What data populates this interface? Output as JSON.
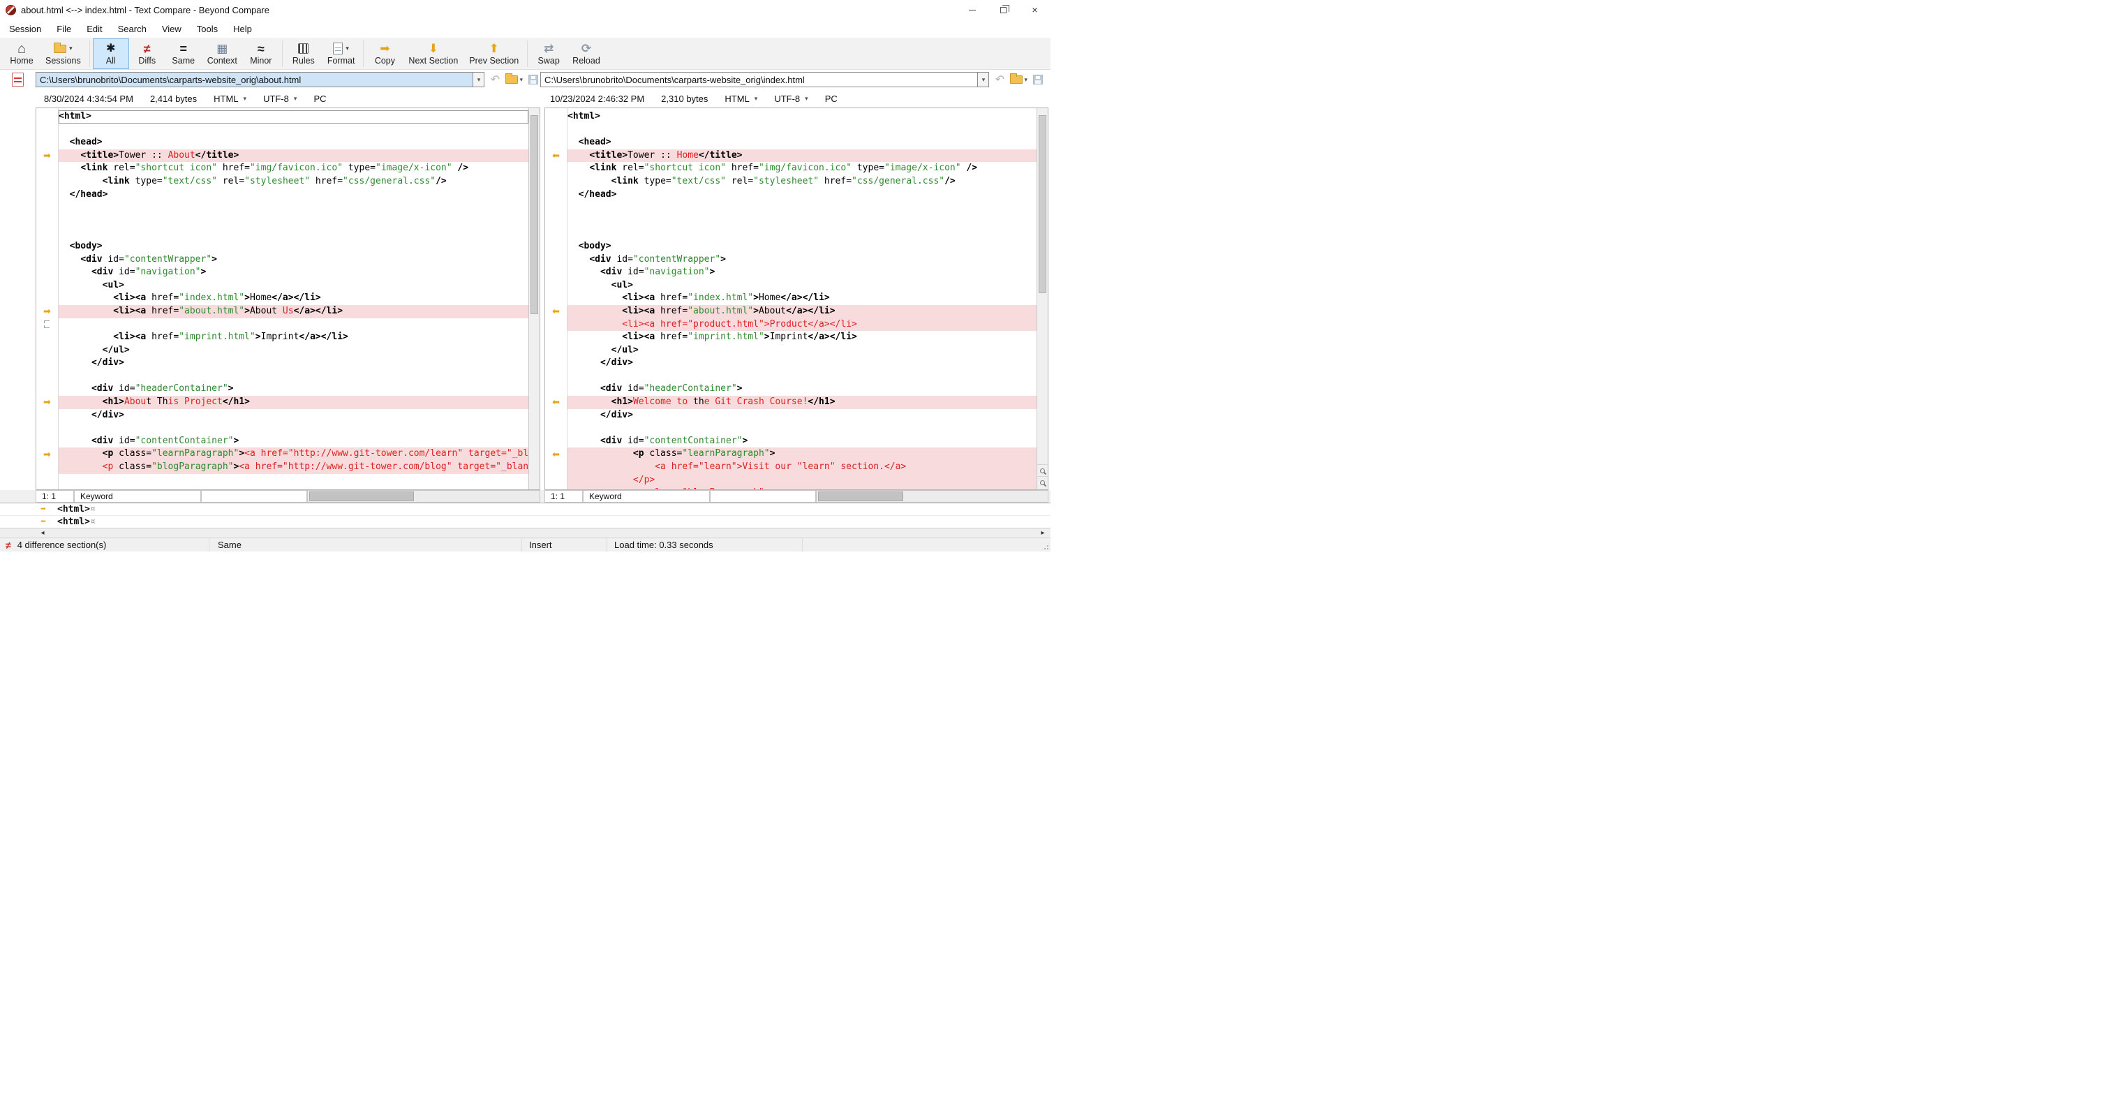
{
  "window": {
    "title": "about.html <--> index.html - Text Compare - Beyond Compare"
  },
  "menu": [
    "Session",
    "File",
    "Edit",
    "Search",
    "View",
    "Tools",
    "Help"
  ],
  "toolbar": {
    "items": [
      {
        "label": "Home"
      },
      {
        "label": "Sessions"
      },
      {
        "label": "All"
      },
      {
        "label": "Diffs"
      },
      {
        "label": "Same"
      },
      {
        "label": "Context"
      },
      {
        "label": "Minor"
      },
      {
        "label": "Rules"
      },
      {
        "label": "Format"
      },
      {
        "label": "Copy"
      },
      {
        "label": "Next Section"
      },
      {
        "label": "Prev Section"
      },
      {
        "label": "Swap"
      },
      {
        "label": "Reload"
      }
    ]
  },
  "icons": {
    "home": "⌂",
    "all": "✱",
    "diffs": "≠",
    "same": "=",
    "context": "▦",
    "minor": "≈",
    "copy": "➡",
    "next_section": "⬇",
    "prev_section": "⬆",
    "swap": "⇄",
    "reload": "⟳",
    "dropdown": "▾",
    "undo": "↶",
    "close": "×",
    "marker_right": "➡",
    "marker_left": "⬅",
    "scroll_left": "◂",
    "scroll_right": "▸",
    "not_equal": "≠"
  },
  "left_file": {
    "path": "C:\\Users\\brunobrito\\Documents\\carparts-website_orig\\about.html",
    "modified": "8/30/2024 4:34:54 PM",
    "size": "2,414 bytes",
    "format": "HTML",
    "encoding": "UTF-8",
    "line_ending": "PC"
  },
  "right_file": {
    "path": "C:\\Users\\brunobrito\\Documents\\carparts-website_orig\\index.html",
    "modified": "10/23/2024 2:46:32 PM",
    "size": "2,310 bytes",
    "format": "HTML",
    "encoding": "UTF-8",
    "line_ending": "PC"
  },
  "left_pane": {
    "cursor": "1: 1",
    "syntax": "Keyword",
    "lines": [
      {
        "cur": 1,
        "seg": [
          [
            "k",
            "<html>"
          ]
        ]
      },
      {},
      {
        "seg": [
          [
            "p",
            "  "
          ],
          [
            "k",
            "<head>"
          ]
        ]
      },
      {
        "m": "r",
        "bg": 1,
        "seg": [
          [
            "p",
            "    "
          ],
          [
            "k",
            "<title>"
          ],
          [
            "p",
            "Tower :: "
          ],
          [
            "d",
            "About"
          ],
          [
            "k",
            "</title>"
          ]
        ]
      },
      {
        "seg": [
          [
            "p",
            "    "
          ],
          [
            "k",
            "<link"
          ],
          [
            "p",
            " rel="
          ],
          [
            "s",
            "\"shortcut icon\""
          ],
          [
            "p",
            " href="
          ],
          [
            "s",
            "\"img/favicon.ico\""
          ],
          [
            "p",
            " type="
          ],
          [
            "s",
            "\"image/x-icon\""
          ],
          [
            "k",
            " />"
          ]
        ]
      },
      {
        "seg": [
          [
            "p",
            "        "
          ],
          [
            "k",
            "<link"
          ],
          [
            "p",
            " type="
          ],
          [
            "s",
            "\"text/css\""
          ],
          [
            "p",
            " rel="
          ],
          [
            "s",
            "\"stylesheet\""
          ],
          [
            "p",
            " href="
          ],
          [
            "s",
            "\"css/general.css\""
          ],
          [
            "k",
            "/>"
          ]
        ]
      },
      {
        "seg": [
          [
            "p",
            "  "
          ],
          [
            "k",
            "</head>"
          ]
        ]
      },
      {},
      {},
      {},
      {
        "seg": [
          [
            "p",
            "  "
          ],
          [
            "k",
            "<body>"
          ]
        ]
      },
      {
        "seg": [
          [
            "p",
            "    "
          ],
          [
            "k",
            "<div"
          ],
          [
            "p",
            " id="
          ],
          [
            "s",
            "\"contentWrapper\""
          ],
          [
            "k",
            ">"
          ]
        ]
      },
      {
        "seg": [
          [
            "p",
            "      "
          ],
          [
            "k",
            "<div"
          ],
          [
            "p",
            " id="
          ],
          [
            "s",
            "\"navigation\""
          ],
          [
            "k",
            ">"
          ]
        ]
      },
      {
        "seg": [
          [
            "p",
            "        "
          ],
          [
            "k",
            "<ul>"
          ]
        ]
      },
      {
        "seg": [
          [
            "p",
            "          "
          ],
          [
            "k",
            "<li><a"
          ],
          [
            "p",
            " href="
          ],
          [
            "s",
            "\"index.html\""
          ],
          [
            "k",
            ">"
          ],
          [
            "p",
            "Home"
          ],
          [
            "k",
            "</a></li>"
          ]
        ]
      },
      {
        "m": "r",
        "bg": 1,
        "seg": [
          [
            "p",
            "          "
          ],
          [
            "k",
            "<li><a"
          ],
          [
            "p",
            " href="
          ],
          [
            "s",
            "\"about.html\""
          ],
          [
            "k",
            ">"
          ],
          [
            "p",
            "About"
          ],
          [
            "d",
            " Us"
          ],
          [
            "k",
            "</a></li>"
          ]
        ]
      },
      {
        "m": "gap"
      },
      {
        "seg": [
          [
            "p",
            "          "
          ],
          [
            "k",
            "<li><a"
          ],
          [
            "p",
            " href="
          ],
          [
            "s",
            "\"imprint.html\""
          ],
          [
            "k",
            ">"
          ],
          [
            "p",
            "Imprint"
          ],
          [
            "k",
            "</a></li>"
          ]
        ]
      },
      {
        "seg": [
          [
            "p",
            "        "
          ],
          [
            "k",
            "</ul>"
          ]
        ]
      },
      {
        "seg": [
          [
            "p",
            "      "
          ],
          [
            "k",
            "</div>"
          ]
        ]
      },
      {},
      {
        "seg": [
          [
            "p",
            "      "
          ],
          [
            "k",
            "<div"
          ],
          [
            "p",
            " id="
          ],
          [
            "s",
            "\"headerContainer\""
          ],
          [
            "k",
            ">"
          ]
        ]
      },
      {
        "m": "r",
        "bg": 1,
        "seg": [
          [
            "p",
            "        "
          ],
          [
            "k",
            "<h1>"
          ],
          [
            "d",
            "Abou"
          ],
          [
            "p",
            "t Th"
          ],
          [
            "d",
            "is Project"
          ],
          [
            "k",
            "</h1>"
          ]
        ]
      },
      {
        "seg": [
          [
            "p",
            "      "
          ],
          [
            "k",
            "</div>"
          ]
        ]
      },
      {},
      {
        "seg": [
          [
            "p",
            "      "
          ],
          [
            "k",
            "<div"
          ],
          [
            "p",
            " id="
          ],
          [
            "s",
            "\"contentContainer\""
          ],
          [
            "k",
            ">"
          ]
        ]
      },
      {
        "m": "r",
        "bg": 1,
        "seg": [
          [
            "p",
            "        "
          ],
          [
            "k",
            "<p"
          ],
          [
            "p",
            " class="
          ],
          [
            "s",
            "\"learnParagraph\""
          ],
          [
            "k",
            ">"
          ],
          [
            "d",
            "<a href=\"http://www.git-tower.com/learn\" target=\"_blank\">"
          ]
        ]
      },
      {
        "bg": 1,
        "seg": [
          [
            "p",
            "        "
          ],
          [
            "d",
            "<p"
          ],
          [
            "p",
            " class="
          ],
          [
            "s",
            "\"blogParagraph\""
          ],
          [
            "k",
            ">"
          ],
          [
            "d",
            "<a href=\"http://www.git-tower.com/blog\" target=\"_blank\">"
          ]
        ]
      }
    ]
  },
  "right_pane": {
    "cursor": "1: 1",
    "syntax": "Keyword",
    "lines": [
      {
        "seg": [
          [
            "k",
            "<html>"
          ]
        ]
      },
      {},
      {
        "seg": [
          [
            "p",
            "  "
          ],
          [
            "k",
            "<head>"
          ]
        ]
      },
      {
        "m": "l",
        "bg": 1,
        "seg": [
          [
            "p",
            "    "
          ],
          [
            "k",
            "<title>"
          ],
          [
            "p",
            "Tower :: "
          ],
          [
            "d",
            "Home"
          ],
          [
            "k",
            "</title>"
          ]
        ]
      },
      {
        "seg": [
          [
            "p",
            "    "
          ],
          [
            "k",
            "<link"
          ],
          [
            "p",
            " rel="
          ],
          [
            "s",
            "\"shortcut icon\""
          ],
          [
            "p",
            " href="
          ],
          [
            "s",
            "\"img/favicon.ico\""
          ],
          [
            "p",
            " type="
          ],
          [
            "s",
            "\"image/x-icon\""
          ],
          [
            "k",
            " />"
          ]
        ]
      },
      {
        "seg": [
          [
            "p",
            "        "
          ],
          [
            "k",
            "<link"
          ],
          [
            "p",
            " type="
          ],
          [
            "s",
            "\"text/css\""
          ],
          [
            "p",
            " rel="
          ],
          [
            "s",
            "\"stylesheet\""
          ],
          [
            "p",
            " href="
          ],
          [
            "s",
            "\"css/general.css\""
          ],
          [
            "k",
            "/>"
          ]
        ]
      },
      {
        "seg": [
          [
            "p",
            "  "
          ],
          [
            "k",
            "</head>"
          ]
        ]
      },
      {},
      {},
      {},
      {
        "seg": [
          [
            "p",
            "  "
          ],
          [
            "k",
            "<body>"
          ]
        ]
      },
      {
        "seg": [
          [
            "p",
            "    "
          ],
          [
            "k",
            "<div"
          ],
          [
            "p",
            " id="
          ],
          [
            "s",
            "\"contentWrapper\""
          ],
          [
            "k",
            ">"
          ]
        ]
      },
      {
        "seg": [
          [
            "p",
            "      "
          ],
          [
            "k",
            "<div"
          ],
          [
            "p",
            " id="
          ],
          [
            "s",
            "\"navigation\""
          ],
          [
            "k",
            ">"
          ]
        ]
      },
      {
        "seg": [
          [
            "p",
            "        "
          ],
          [
            "k",
            "<ul>"
          ]
        ]
      },
      {
        "seg": [
          [
            "p",
            "          "
          ],
          [
            "k",
            "<li><a"
          ],
          [
            "p",
            " href="
          ],
          [
            "s",
            "\"index.html\""
          ],
          [
            "k",
            ">"
          ],
          [
            "p",
            "Home"
          ],
          [
            "k",
            "</a></li>"
          ]
        ]
      },
      {
        "m": "l",
        "bg": 1,
        "seg": [
          [
            "p",
            "          "
          ],
          [
            "k",
            "<li><a"
          ],
          [
            "p",
            " href="
          ],
          [
            "s",
            "\"about.html\""
          ],
          [
            "k",
            ">"
          ],
          [
            "p",
            "About"
          ],
          [
            "k",
            "</a></li>"
          ]
        ]
      },
      {
        "bg": 1,
        "seg": [
          [
            "p",
            "          "
          ],
          [
            "d",
            "<li><a href=\"product.html\">Product</a></li>"
          ]
        ]
      },
      {
        "seg": [
          [
            "p",
            "          "
          ],
          [
            "k",
            "<li><a"
          ],
          [
            "p",
            " href="
          ],
          [
            "s",
            "\"imprint.html\""
          ],
          [
            "k",
            ">"
          ],
          [
            "p",
            "Imprint"
          ],
          [
            "k",
            "</a></li>"
          ]
        ]
      },
      {
        "seg": [
          [
            "p",
            "        "
          ],
          [
            "k",
            "</ul>"
          ]
        ]
      },
      {
        "seg": [
          [
            "p",
            "      "
          ],
          [
            "k",
            "</div>"
          ]
        ]
      },
      {},
      {
        "seg": [
          [
            "p",
            "      "
          ],
          [
            "k",
            "<div"
          ],
          [
            "p",
            " id="
          ],
          [
            "s",
            "\"headerContainer\""
          ],
          [
            "k",
            ">"
          ]
        ]
      },
      {
        "m": "l",
        "bg": 1,
        "seg": [
          [
            "p",
            "        "
          ],
          [
            "k",
            "<h1>"
          ],
          [
            "d",
            "Welcome to "
          ],
          [
            "p",
            "th"
          ],
          [
            "d",
            "e Git Crash Course!"
          ],
          [
            "k",
            "</h1>"
          ]
        ]
      },
      {
        "seg": [
          [
            "p",
            "      "
          ],
          [
            "k",
            "</div>"
          ]
        ]
      },
      {},
      {
        "seg": [
          [
            "p",
            "      "
          ],
          [
            "k",
            "<div"
          ],
          [
            "p",
            " id="
          ],
          [
            "s",
            "\"contentContainer\""
          ],
          [
            "k",
            ">"
          ]
        ]
      },
      {
        "m": "l",
        "bg": 1,
        "seg": [
          [
            "p",
            "            "
          ],
          [
            "k",
            "<p"
          ],
          [
            "p",
            " class="
          ],
          [
            "s",
            "\"learnParagraph\""
          ],
          [
            "k",
            ">"
          ]
        ]
      },
      {
        "bg": 1,
        "seg": [
          [
            "p",
            "                "
          ],
          [
            "d",
            "<a href=\"learn\">Visit our \"learn\" section.</a>"
          ]
        ]
      },
      {
        "bg": 1,
        "seg": [
          [
            "p",
            "            "
          ],
          [
            "d",
            "</p>"
          ]
        ]
      },
      {
        "bg": 1,
        "seg": [
          [
            "p",
            "            "
          ],
          [
            "d",
            "<p class=\"blogParagraph\">"
          ]
        ]
      }
    ]
  },
  "detail": {
    "rows": [
      {
        "dir": "right",
        "text": "<html>",
        "eol": "¤"
      },
      {
        "dir": "left",
        "text": "<html>",
        "eol": "¤"
      }
    ]
  },
  "status_bar": {
    "diff_count": "4 difference section(s)",
    "compare_state": "Same",
    "mode": "Insert",
    "load_time": "Load time: 0.33 seconds"
  },
  "colors": {
    "diff_text": "#dd2222",
    "diff_bg": "#f8dbdd",
    "string_green": "#2f8a2f",
    "marker_gold": "#e8a318",
    "selection_blue": "#cfe4f7"
  }
}
